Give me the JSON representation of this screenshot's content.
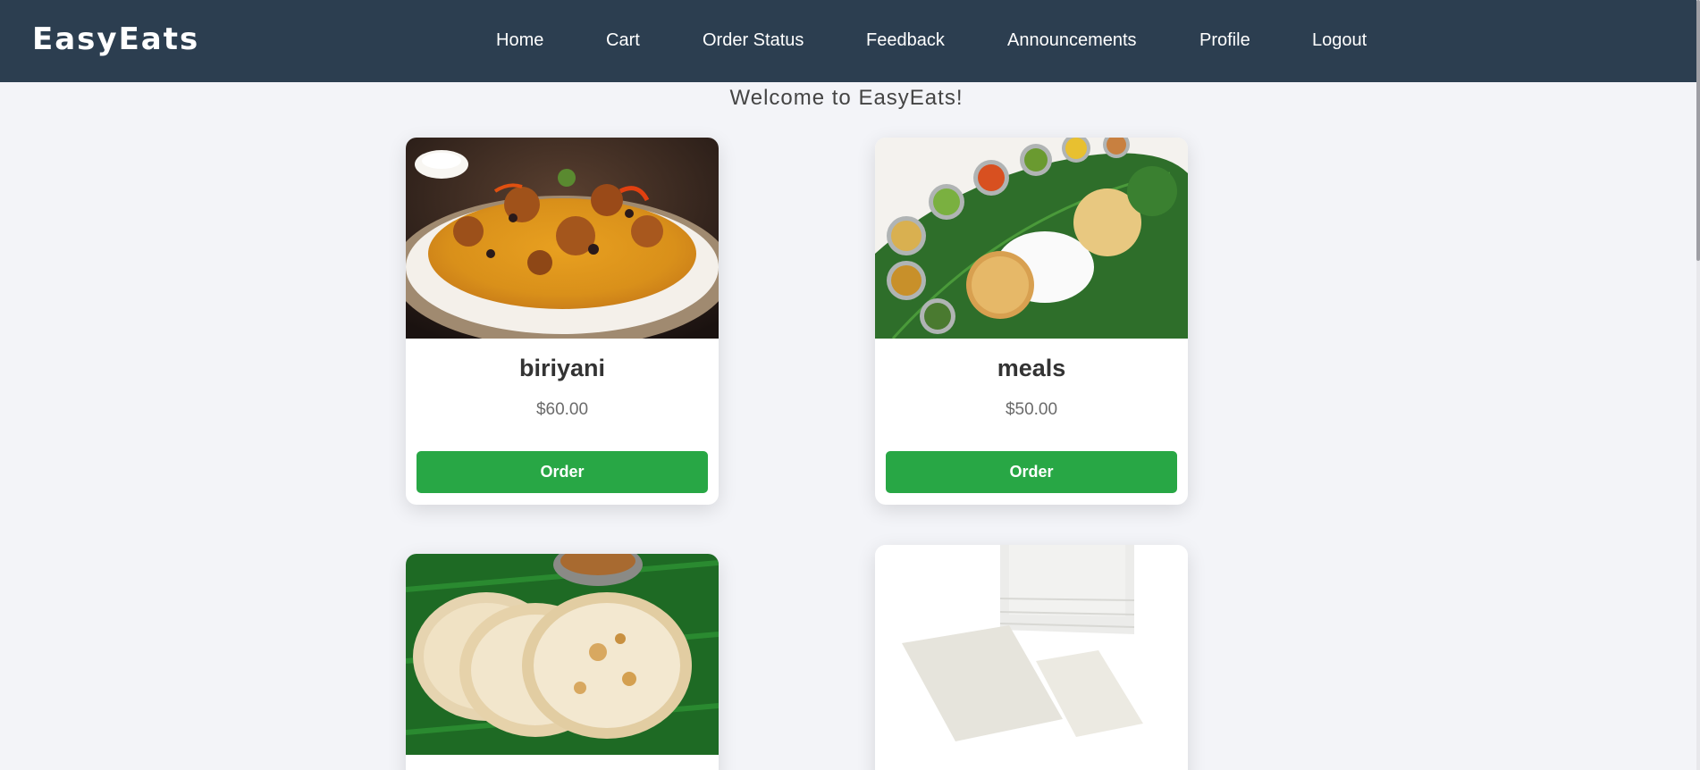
{
  "brand": "EasyEats",
  "nav": {
    "home": "Home",
    "cart": "Cart",
    "order_status": "Order Status",
    "feedback": "Feedback",
    "announcements": "Announcements",
    "profile": "Profile",
    "logout": "Logout"
  },
  "welcome": "Welcome to EasyEats!",
  "products": [
    {
      "name": "biriyani",
      "price": "$60.00",
      "button": "Order",
      "image": "biriyani-photo"
    },
    {
      "name": "meals",
      "price": "$50.00",
      "button": "Order",
      "image": "meals-thali-photo"
    },
    {
      "name": "",
      "price": "",
      "button": "",
      "image": "parotta-photo"
    },
    {
      "name": "",
      "price": "",
      "button": "",
      "image": "appam-paper-photo"
    }
  ],
  "colors": {
    "navbar": "#2c3e50",
    "page_background": "#f3f4f8",
    "order_button": "#28a745"
  }
}
